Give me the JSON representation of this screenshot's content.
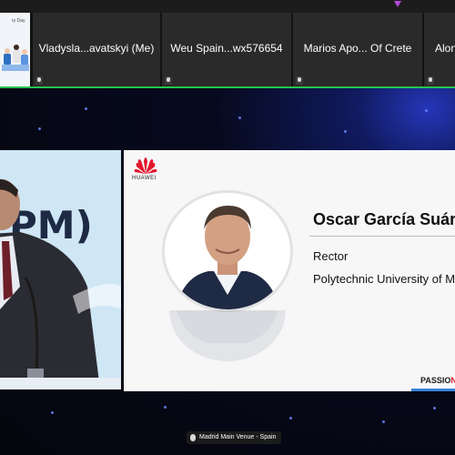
{
  "participants": [
    {
      "name": "",
      "thumbnail_caption": "ry Day"
    },
    {
      "name": "Vladysla...avatskyi (Me)"
    },
    {
      "name": "Weu Spain...wx576654"
    },
    {
      "name": "Marios Apo... Of Crete"
    },
    {
      "name": "Alon"
    }
  ],
  "left_video": {
    "backdrop_text": "PM)"
  },
  "slide": {
    "logo_text": "HUAWEI",
    "speaker_name": "Oscar García Suárez",
    "speaker_title": "Rector",
    "speaker_org": "Polytechnic University of Madrid",
    "tagline_prefix": "PASSIO",
    "tagline_accent": "N"
  },
  "venue_label": "Madrid Main Venue - Spain",
  "colors": {
    "active_speaker_border": "#23c552",
    "brand_red": "#e4162c",
    "backdrop": "#070a1e"
  }
}
